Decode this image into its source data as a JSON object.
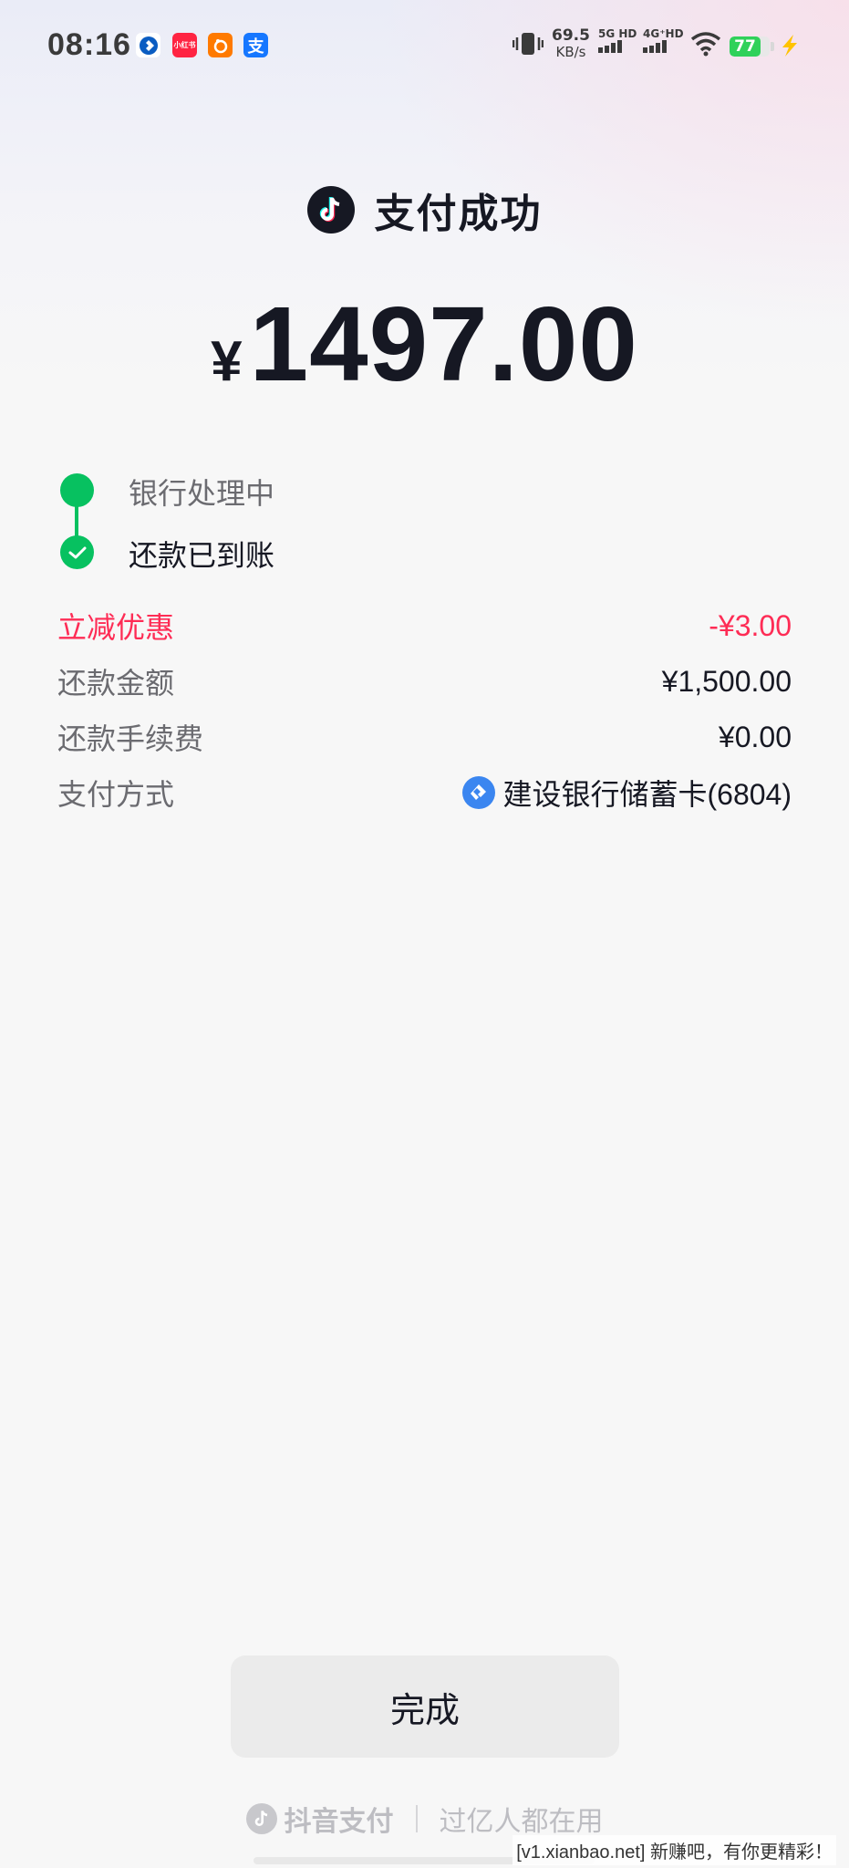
{
  "status_bar": {
    "time": "08:16",
    "net_speed_value": "69.5",
    "net_speed_unit": "KB/s",
    "signal1_label": "5G HD",
    "signal2_label": "4G⁺HD",
    "battery_level": "77",
    "notification_icons": [
      "ccb-bank-icon",
      "xiaohongshu-icon",
      "mall-app-icon",
      "alipay-icon"
    ],
    "xhs_text": "小红书",
    "alipay_text": "支"
  },
  "header": {
    "title": "支付成功",
    "logo_icon": "douyin-icon"
  },
  "amount": {
    "currency": "¥",
    "value": "1497.00"
  },
  "timeline": [
    {
      "label": "银行处理中",
      "state": "done"
    },
    {
      "label": "还款已到账",
      "state": "done-checked"
    }
  ],
  "details": [
    {
      "label": "立减优惠",
      "value": "-¥3.00",
      "highlight": true
    },
    {
      "label": "还款金额",
      "value": "¥1,500.00"
    },
    {
      "label": "还款手续费",
      "value": "¥0.00"
    },
    {
      "label": "支付方式",
      "value": "建设银行储蓄卡(6804)",
      "icon": "ccb-bank-icon"
    }
  ],
  "done_button": "完成",
  "footer": {
    "brand": "抖音支付",
    "slogan": "过亿人都在用"
  },
  "watermark": "[v1.xianbao.net] 新赚吧，有你更精彩！",
  "colors": {
    "accent_green": "#07c160",
    "discount_red": "#fe2c55",
    "text_primary": "#161823",
    "text_secondary": "#6b6b70"
  }
}
